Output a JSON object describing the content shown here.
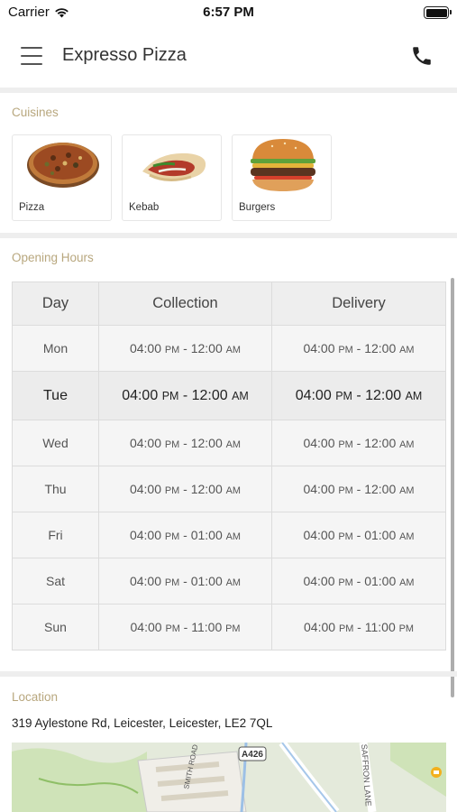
{
  "status_bar": {
    "carrier": "Carrier",
    "time": "6:57 PM"
  },
  "header": {
    "title": "Expresso Pizza"
  },
  "cuisines": {
    "label": "Cuisines",
    "items": [
      {
        "name": "Pizza"
      },
      {
        "name": "Kebab"
      },
      {
        "name": "Burgers"
      }
    ]
  },
  "opening_hours": {
    "label": "Opening Hours",
    "columns": [
      "Day",
      "Collection",
      "Delivery"
    ],
    "rows": [
      {
        "day": "Mon",
        "collection": {
          "open": "04:00",
          "open_ampm": "PM",
          "close": "12:00",
          "close_ampm": "AM"
        },
        "delivery": {
          "open": "04:00",
          "open_ampm": "PM",
          "close": "12:00",
          "close_ampm": "AM"
        }
      },
      {
        "day": "Tue",
        "collection": {
          "open": "04:00",
          "open_ampm": "PM",
          "close": "12:00",
          "close_ampm": "AM"
        },
        "delivery": {
          "open": "04:00",
          "open_ampm": "PM",
          "close": "12:00",
          "close_ampm": "AM"
        }
      },
      {
        "day": "Wed",
        "collection": {
          "open": "04:00",
          "open_ampm": "PM",
          "close": "12:00",
          "close_ampm": "AM"
        },
        "delivery": {
          "open": "04:00",
          "open_ampm": "PM",
          "close": "12:00",
          "close_ampm": "AM"
        }
      },
      {
        "day": "Thu",
        "collection": {
          "open": "04:00",
          "open_ampm": "PM",
          "close": "12:00",
          "close_ampm": "AM"
        },
        "delivery": {
          "open": "04:00",
          "open_ampm": "PM",
          "close": "12:00",
          "close_ampm": "AM"
        }
      },
      {
        "day": "Fri",
        "collection": {
          "open": "04:00",
          "open_ampm": "PM",
          "close": "01:00",
          "close_ampm": "AM"
        },
        "delivery": {
          "open": "04:00",
          "open_ampm": "PM",
          "close": "01:00",
          "close_ampm": "AM"
        }
      },
      {
        "day": "Sat",
        "collection": {
          "open": "04:00",
          "open_ampm": "PM",
          "close": "01:00",
          "close_ampm": "AM"
        },
        "delivery": {
          "open": "04:00",
          "open_ampm": "PM",
          "close": "01:00",
          "close_ampm": "AM"
        }
      },
      {
        "day": "Sun",
        "collection": {
          "open": "04:00",
          "open_ampm": "PM",
          "close": "11:00",
          "close_ampm": "PM"
        },
        "delivery": {
          "open": "04:00",
          "open_ampm": "PM",
          "close": "11:00",
          "close_ampm": "PM"
        }
      }
    ]
  },
  "location": {
    "label": "Location",
    "address": "319 Aylestone Rd, Leicester, Leicester, LE2 7QL",
    "map_labels": {
      "road_badge": "A426",
      "street_1": "SMITH ROAD",
      "street_2": "SAFFRON LANE"
    }
  },
  "colors": {
    "section_label": "#b8a77e",
    "separator": "#eeeeee"
  },
  "icons": {
    "menu": "hamburger-menu-icon",
    "call": "phone-icon",
    "signal": "wifi-icon",
    "battery": "battery-icon"
  }
}
